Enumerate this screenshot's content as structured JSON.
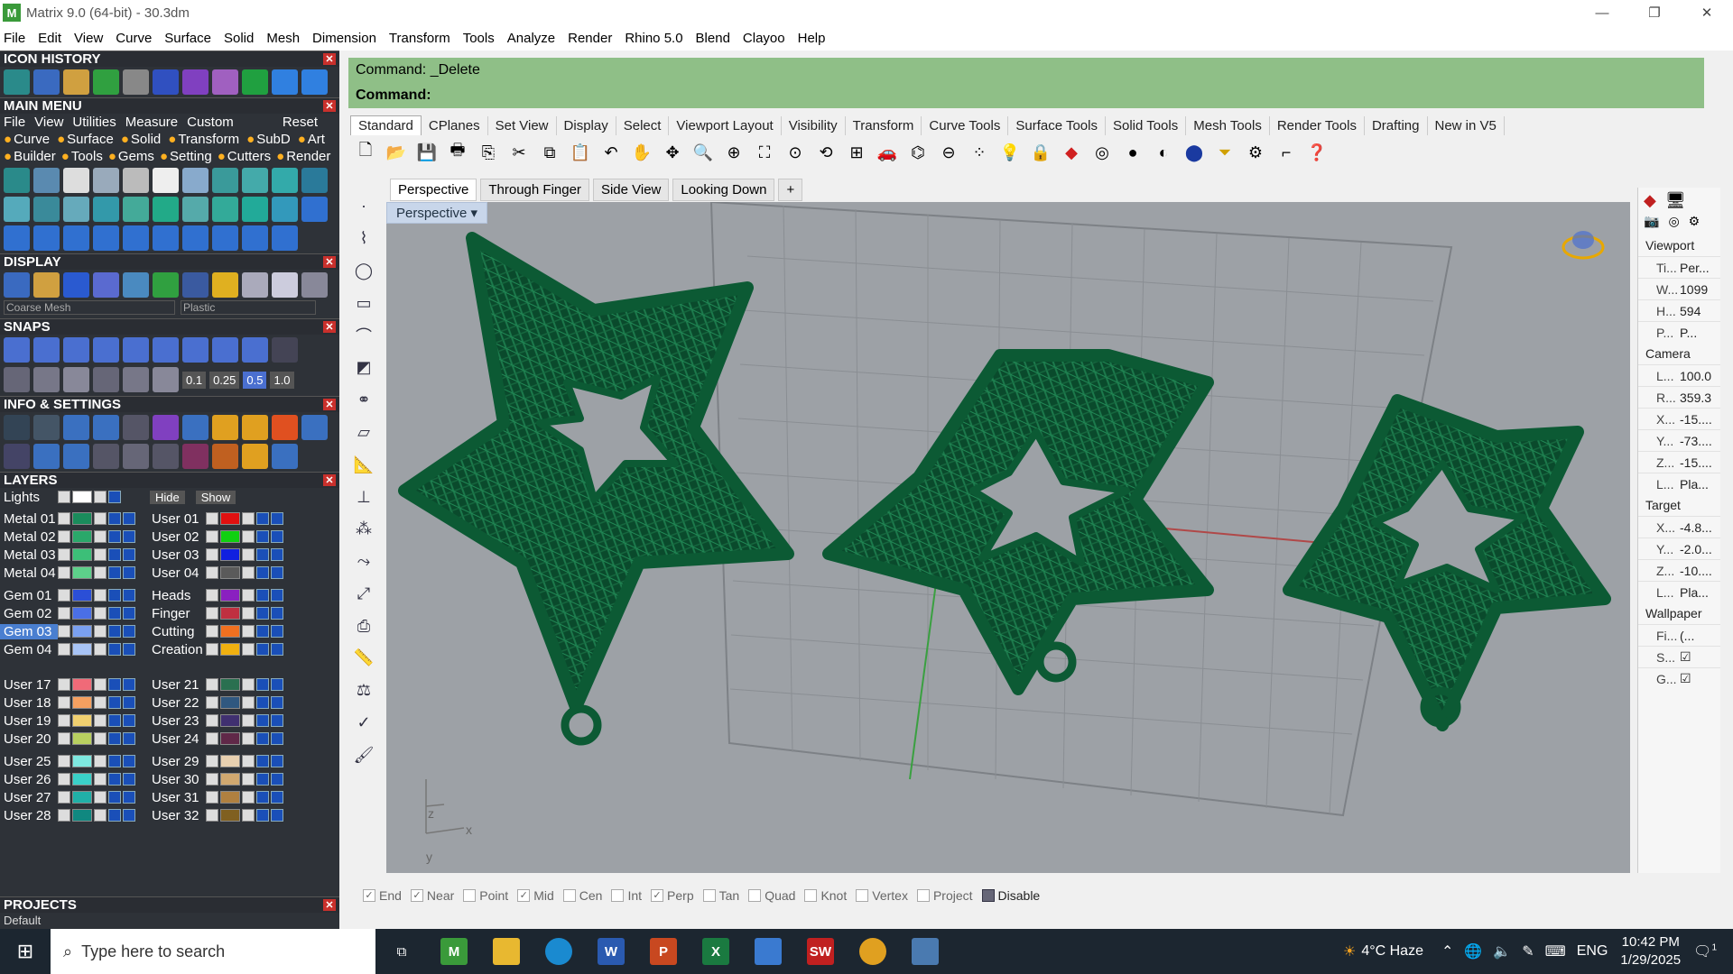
{
  "window": {
    "title": "Matrix 9.0 (64-bit) - 30.3dm",
    "min": "—",
    "max": "❐",
    "close": "✕"
  },
  "menu": [
    "File",
    "Edit",
    "View",
    "Curve",
    "Surface",
    "Solid",
    "Mesh",
    "Dimension",
    "Transform",
    "Tools",
    "Analyze",
    "Render",
    "Rhino 5.0",
    "Blend",
    "Clayoo",
    "Help"
  ],
  "left": {
    "icon_history": "ICON HISTORY",
    "main_menu": "MAIN MENU",
    "mm_menu": [
      "File",
      "View",
      "Utilities",
      "Measure",
      "Custom"
    ],
    "mm_reset": "Reset",
    "mm_row1": [
      "Curve",
      "Surface",
      "Solid",
      "Transform",
      "SubD",
      "Art"
    ],
    "mm_row2": [
      "Builder",
      "Tools",
      "Gems",
      "Setting",
      "Cutters",
      "Render"
    ],
    "display": "DISPLAY",
    "display_mesh": "Coarse Mesh",
    "display_material": "Plastic",
    "snaps": "SNAPS",
    "snap_values": [
      "0.1",
      "0.25",
      "0.5",
      "1.0"
    ],
    "info": "INFO & SETTINGS",
    "layers": "LAYERS",
    "lights": "Lights",
    "hide": "Hide",
    "show": "Show",
    "layers_left": [
      {
        "name": "Metal 01",
        "color": "#1a8c5c"
      },
      {
        "name": "Metal 02",
        "color": "#2aa86a"
      },
      {
        "name": "Metal 03",
        "color": "#3cbf78"
      },
      {
        "name": "Metal 04",
        "color": "#5dd08a"
      },
      {
        "name": "Gem 01",
        "color": "#2b4fd6"
      },
      {
        "name": "Gem 02",
        "color": "#4a6fe6"
      },
      {
        "name": "Gem 03",
        "color": "#7aa0f0"
      },
      {
        "name": "Gem 04",
        "color": "#a8c4f6"
      },
      {
        "name": "User 17",
        "color": "#f06a78"
      },
      {
        "name": "User 18",
        "color": "#f5a060"
      },
      {
        "name": "User 19",
        "color": "#f0d070"
      },
      {
        "name": "User 20",
        "color": "#b8d060"
      },
      {
        "name": "User 25",
        "color": "#7ee8e0"
      },
      {
        "name": "User 26",
        "color": "#3ad0c8"
      },
      {
        "name": "User 27",
        "color": "#20b0a8"
      },
      {
        "name": "User 28",
        "color": "#108880"
      }
    ],
    "layers_right": [
      {
        "name": "User 01",
        "color": "#e01010"
      },
      {
        "name": "User 02",
        "color": "#10d010"
      },
      {
        "name": "User 03",
        "color": "#1020e0"
      },
      {
        "name": "User 04",
        "color": "#5a5a5a"
      },
      {
        "name": "Heads",
        "color": "#8a20c0"
      },
      {
        "name": "Finger",
        "color": "#c03040"
      },
      {
        "name": "Cutting",
        "color": "#f07020"
      },
      {
        "name": "Creation",
        "color": "#f0b010"
      },
      {
        "name": "User 21",
        "color": "#2a7050"
      },
      {
        "name": "User 22",
        "color": "#305880"
      },
      {
        "name": "User 23",
        "color": "#403070"
      },
      {
        "name": "User 24",
        "color": "#602848"
      },
      {
        "name": "User 29",
        "color": "#e8d0b0"
      },
      {
        "name": "User 30",
        "color": "#d0a870"
      },
      {
        "name": "User 31",
        "color": "#b08040"
      },
      {
        "name": "User 32",
        "color": "#806020"
      }
    ],
    "projects": "PROJECTS",
    "projects_default": "Default"
  },
  "command": {
    "line1": "Command: _Delete",
    "line2": "Command:"
  },
  "toolbar_tabs": [
    "Standard",
    "CPlanes",
    "Set View",
    "Display",
    "Select",
    "Viewport Layout",
    "Visibility",
    "Transform",
    "Curve Tools",
    "Surface Tools",
    "Solid Tools",
    "Mesh Tools",
    "Render Tools",
    "Drafting",
    "New in V5"
  ],
  "viewport_tabs": [
    "Perspective",
    "Through Finger",
    "Side View",
    "Looking Down",
    "+"
  ],
  "viewport": {
    "label": "Perspective",
    "axis_x": "x",
    "axis_y": "y",
    "axis_z": "z"
  },
  "props": {
    "viewport_title": "Viewport",
    "viewport_rows": [
      {
        "k": "Ti...",
        "v": "Per..."
      },
      {
        "k": "W...",
        "v": "1099"
      },
      {
        "k": "H...",
        "v": "594"
      },
      {
        "k": "P...",
        "v": "P..."
      }
    ],
    "camera_title": "Camera",
    "camera_rows": [
      {
        "k": "L...",
        "v": "100.0"
      },
      {
        "k": "R...",
        "v": "359.3"
      },
      {
        "k": "X...",
        "v": "-15...."
      },
      {
        "k": "Y...",
        "v": "-73...."
      },
      {
        "k": "Z...",
        "v": "-15...."
      },
      {
        "k": "L...",
        "v": "Pla..."
      }
    ],
    "target_title": "Target",
    "target_rows": [
      {
        "k": "X...",
        "v": "-4.8..."
      },
      {
        "k": "Y...",
        "v": "-2.0..."
      },
      {
        "k": "Z...",
        "v": "-10...."
      },
      {
        "k": "L...",
        "v": "Pla..."
      }
    ],
    "wallpaper_title": "Wallpaper",
    "wallpaper_rows": [
      {
        "k": "Fi...",
        "v": "(..."
      },
      {
        "k": "S...",
        "v": "☑"
      },
      {
        "k": "G...",
        "v": "☑"
      }
    ]
  },
  "osnaps": [
    {
      "label": "End",
      "checked": true
    },
    {
      "label": "Near",
      "checked": true
    },
    {
      "label": "Point",
      "checked": false
    },
    {
      "label": "Mid",
      "checked": true
    },
    {
      "label": "Cen",
      "checked": false
    },
    {
      "label": "Int",
      "checked": false
    },
    {
      "label": "Perp",
      "checked": true
    },
    {
      "label": "Tan",
      "checked": false
    },
    {
      "label": "Quad",
      "checked": false
    },
    {
      "label": "Knot",
      "checked": false
    },
    {
      "label": "Vertex",
      "checked": false
    },
    {
      "label": "Project",
      "checked": false
    },
    {
      "label": "Disable",
      "checked": false
    }
  ],
  "taskbar": {
    "search_placeholder": "Type here to search",
    "weather": "4°C  Haze",
    "lang": "ENG",
    "time": "10:42 PM",
    "date": "1/29/2025",
    "notif": "1"
  },
  "colors": {
    "accent": "#8fbf87",
    "object": "#0e5a36",
    "panel": "#2e3238"
  }
}
